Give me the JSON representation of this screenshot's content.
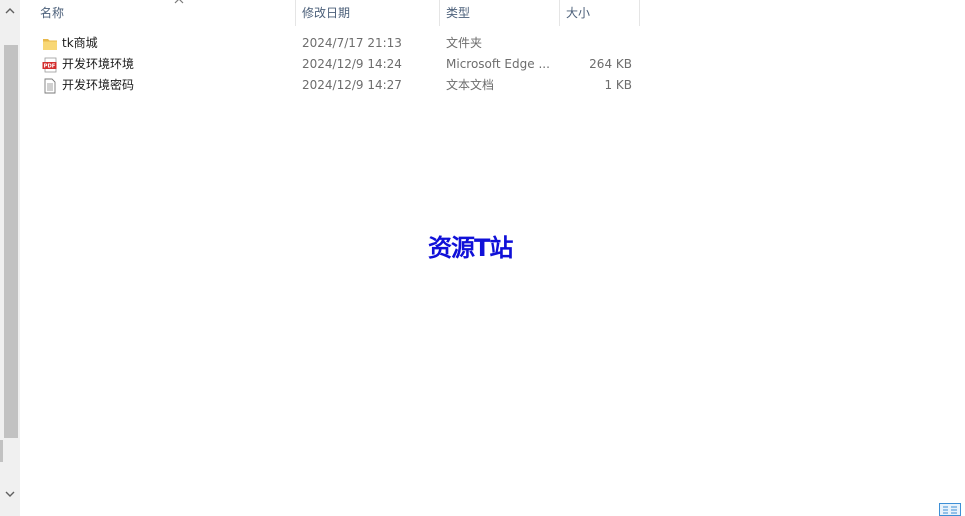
{
  "columns": {
    "name": "名称",
    "date": "修改日期",
    "type": "类型",
    "size": "大小"
  },
  "files": [
    {
      "name": "tk商城",
      "date": "2024/7/17 21:13",
      "type": "文件夹",
      "size": "",
      "icon": "folder-icon"
    },
    {
      "name": "开发环境环境",
      "date": "2024/12/9 14:24",
      "type": "Microsoft Edge ...",
      "size": "264 KB",
      "icon": "pdf-icon"
    },
    {
      "name": "开发环境密码",
      "date": "2024/12/9 14:27",
      "type": "文本文档",
      "size": "1 KB",
      "icon": "text-file-icon"
    }
  ],
  "watermark": "资源T站",
  "colors": {
    "header_text": "#4c607a",
    "watermark": "#1010d8",
    "folder": "#f8d775",
    "pdf": "#d32f2f"
  }
}
